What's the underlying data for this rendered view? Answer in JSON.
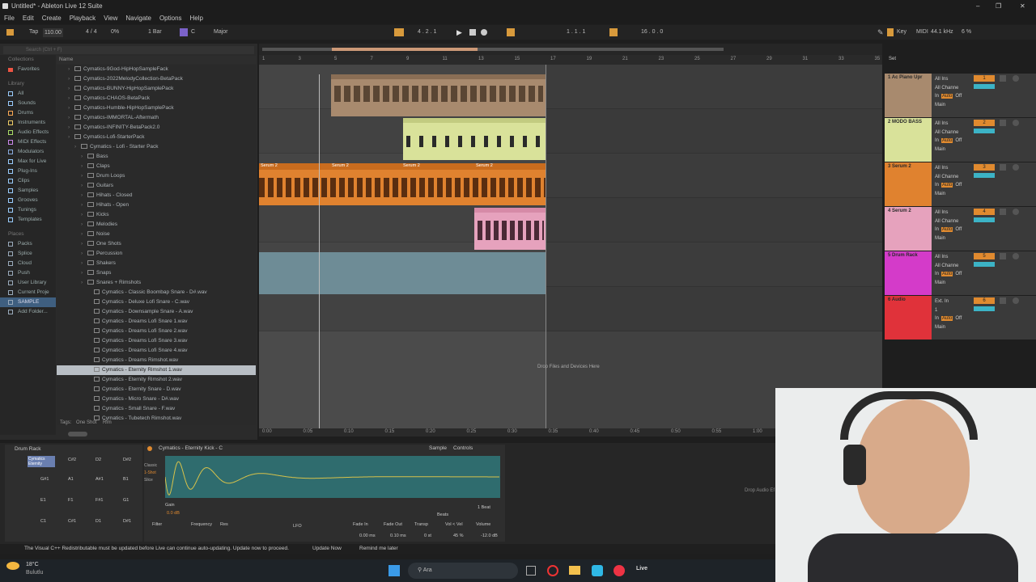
{
  "title": "Untitled* - Ableton Live 12 Suite",
  "menu": [
    "File",
    "Edit",
    "Create",
    "Playback",
    "View",
    "Navigate",
    "Options",
    "Help"
  ],
  "control_bar": {
    "tap": "Tap",
    "tempo": "110.00",
    "sig": "4 / 4",
    "cpu": "0%",
    "quant": "1 Bar",
    "key": "C",
    "scale": "Major",
    "position": "4 . 2 . 1",
    "loop_start": "1 . 1 . 1",
    "loop_len": "16 . 0 . 0",
    "key_label": "Key",
    "midi_label": "MIDI",
    "sample_rate": "44.1 kHz",
    "cpu_load": "6 %"
  },
  "browser": {
    "search_placeholder": "Search (Ctrl + F)",
    "collections_label": "Collections",
    "favorites": "Favorites",
    "library_label": "Library",
    "library_items": [
      "All",
      "Sounds",
      "Drums",
      "Instruments",
      "Audio Effects",
      "MIDI Effects",
      "Modulators",
      "Max for Live",
      "Plug-Ins",
      "Clips",
      "Samples",
      "Grooves",
      "Tunings",
      "Templates"
    ],
    "places_label": "Places",
    "places_items": [
      "Packs",
      "Splice",
      "Cloud",
      "Push",
      "User Library",
      "Current Proje",
      "SAMPLE",
      "Add Folder..."
    ],
    "name_header": "Name",
    "tree": [
      {
        "label": "Cymatics-9God-HipHopSampleFack",
        "indent": 1,
        "type": "folder"
      },
      {
        "label": "Cymatics-2022MelodyCollection-BetaPack",
        "indent": 1,
        "type": "folder"
      },
      {
        "label": "Cymatics-BUNNY-HipHopSamplePack",
        "indent": 1,
        "type": "folder"
      },
      {
        "label": "Cymatics-CHAOS-BetaPack",
        "indent": 1,
        "type": "folder"
      },
      {
        "label": "Cymatics-Humble-HipHopSamplePack",
        "indent": 1,
        "type": "folder"
      },
      {
        "label": "Cymatics-IMMORTAL-Aftermath",
        "indent": 1,
        "type": "folder"
      },
      {
        "label": "Cymatics-INFINITY-BetaPack2.0",
        "indent": 1,
        "type": "folder"
      },
      {
        "label": "Cymatics-Lofi-StarterPack",
        "indent": 1,
        "type": "folder"
      },
      {
        "label": "Cymatics - Lofi - Starter Pack",
        "indent": 2,
        "type": "folder"
      },
      {
        "label": "Bass",
        "indent": 3,
        "type": "folder"
      },
      {
        "label": "Claps",
        "indent": 3,
        "type": "folder"
      },
      {
        "label": "Drum Loops",
        "indent": 3,
        "type": "folder"
      },
      {
        "label": "Guitars",
        "indent": 3,
        "type": "folder"
      },
      {
        "label": "Hihats - Closed",
        "indent": 3,
        "type": "folder"
      },
      {
        "label": "Hihats - Open",
        "indent": 3,
        "type": "folder"
      },
      {
        "label": "Kicks",
        "indent": 3,
        "type": "folder"
      },
      {
        "label": "Melodies",
        "indent": 3,
        "type": "folder"
      },
      {
        "label": "Noise",
        "indent": 3,
        "type": "folder"
      },
      {
        "label": "One Shots",
        "indent": 3,
        "type": "folder"
      },
      {
        "label": "Percussion",
        "indent": 3,
        "type": "folder"
      },
      {
        "label": "Shakers",
        "indent": 3,
        "type": "folder"
      },
      {
        "label": "Snaps",
        "indent": 3,
        "type": "folder"
      },
      {
        "label": "Snares + Rimshots",
        "indent": 3,
        "type": "folder"
      },
      {
        "label": "Cymatics - Classic Boombap Snare - D#.wav",
        "indent": 4,
        "type": "file"
      },
      {
        "label": "Cymatics - Deluxe Lofi Snare - C.wav",
        "indent": 4,
        "type": "file"
      },
      {
        "label": "Cymatics - Downsample Snare - A.wav",
        "indent": 4,
        "type": "file"
      },
      {
        "label": "Cymatics - Dreams Lofi Snare 1.wav",
        "indent": 4,
        "type": "file"
      },
      {
        "label": "Cymatics - Dreams Lofi Snare 2.wav",
        "indent": 4,
        "type": "file"
      },
      {
        "label": "Cymatics - Dreams Lofi Snare 3.wav",
        "indent": 4,
        "type": "file"
      },
      {
        "label": "Cymatics - Dreams Lofi Snare 4.wav",
        "indent": 4,
        "type": "file"
      },
      {
        "label": "Cymatics - Dreams Rimshot.wav",
        "indent": 4,
        "type": "file"
      },
      {
        "label": "Cymatics - Eternity Rimshot 1.wav",
        "indent": 4,
        "type": "file",
        "selected": true
      },
      {
        "label": "Cymatics - Eternity Rimshot 2.wav",
        "indent": 4,
        "type": "file"
      },
      {
        "label": "Cymatics - Eternity Snare - D.wav",
        "indent": 4,
        "type": "file"
      },
      {
        "label": "Cymatics - Micro Snare - D#.wav",
        "indent": 4,
        "type": "file"
      },
      {
        "label": "Cymatics - Small Snare - F.wav",
        "indent": 4,
        "type": "file"
      },
      {
        "label": "Cymatics - Tubetech Rimshot.wav",
        "indent": 4,
        "type": "file"
      }
    ],
    "tags_label": "Tags:",
    "tags": [
      "One Shot",
      "Rim"
    ]
  },
  "ruler": [
    "1",
    "3",
    "5",
    "7",
    "9",
    "11",
    "13",
    "15",
    "17",
    "19",
    "21",
    "23",
    "25",
    "27",
    "29",
    "31",
    "33",
    "35"
  ],
  "time_ruler": [
    "0:00",
    "0:05",
    "0:10",
    "0:15",
    "0:20",
    "0:25",
    "0:30",
    "0:35",
    "0:40",
    "0:45",
    "0:50",
    "0:55",
    "1:00"
  ],
  "drop_text": "Drop Files and Devices Here",
  "tracks": [
    {
      "num": "1",
      "name": "1 Ac Piano Upr",
      "color": "#a88a6e",
      "input": "All Ins",
      "channel": "All Channe",
      "out": "Main"
    },
    {
      "num": "2",
      "name": "2 MODO BASS",
      "color": "#d9e29a",
      "input": "All Ins",
      "channel": "All Channe",
      "out": "Main"
    },
    {
      "num": "3",
      "name": "3 Serum 2",
      "color": "#e0822f",
      "input": "All Ins",
      "channel": "All Channe",
      "out": "Main"
    },
    {
      "num": "4",
      "name": "4 Serum 2",
      "color": "#e6a2bd",
      "input": "All Ins",
      "channel": "All Channe",
      "out": "Main"
    },
    {
      "num": "5",
      "name": "5 Drum Rack",
      "color": "#d43bc9",
      "input": "All Ins",
      "channel": "All Channe",
      "out": "Main"
    },
    {
      "num": "6",
      "name": "6 Audio",
      "color": "#e0323a",
      "input": "Ext. In",
      "channel": "1",
      "out": "Main"
    }
  ],
  "clip_labels": {
    "serum_a": "Serum 2",
    "serum_b": "Serum 2",
    "serum_c": "Serum 2",
    "serum_d": "Serum 2"
  },
  "track_toggles": {
    "in": "In",
    "auto": "Auto",
    "off": "Off",
    "set": "Set"
  },
  "device": {
    "rack_title": "Drum Rack",
    "pad_selected": "Cymatics Eternity",
    "pads": [
      "G#1",
      "A1",
      "A#1",
      "B1",
      "E1",
      "F1",
      "F#1",
      "G1",
      "C1",
      "C#1",
      "D1",
      "D#1"
    ],
    "pad_top": [
      "C#2",
      "D2",
      "D#2"
    ],
    "simpler_title": "Cymatics - Eternity Kick - C",
    "tabs": [
      "Sample",
      "Controls"
    ],
    "modes": [
      "Classic",
      "1-Shot",
      "Slice"
    ],
    "gain_label": "Gain",
    "gain_value": "0.0 dB",
    "filter_label": "Filter",
    "freq_label": "Frequency",
    "res_label": "Res",
    "lfo_label": "LFO",
    "fade_in_label": "Fade In",
    "fade_in": "0.00 ms",
    "fade_out_label": "Fade Out",
    "fade_out": "0.10 ms",
    "transp_label": "Transp",
    "transp": "0 st",
    "vol_vel_label": "Vol < Vel",
    "vol_vel": "45 %",
    "volume_label": "Volume",
    "volume": "-12.0 dB",
    "beat": "1 Beat",
    "beats_label": "Beats",
    "drop_audio": "Drop Audio Ef"
  },
  "status": {
    "message": "The Visual C++ Redistributable must be updated before Live can continue auto-updating. Update now to proceed.",
    "update_now": "Update Now",
    "remind": "Remind me later"
  },
  "taskbar": {
    "weather_temp": "18°C",
    "weather_desc": "Bulutlu",
    "search": "Ara"
  }
}
